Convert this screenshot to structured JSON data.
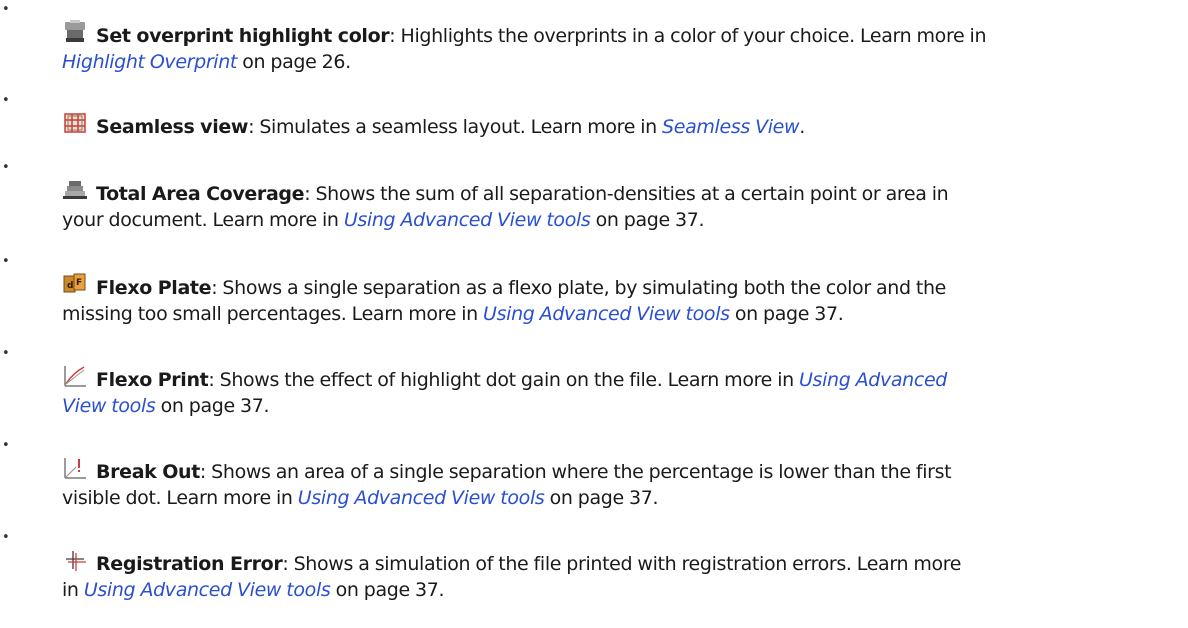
{
  "colors": {
    "text": "#1a1a1a",
    "link": "#2a4fd0",
    "icon_red": "#d23a3a",
    "icon_gray": "#8a8a8a"
  },
  "items": [
    {
      "icon": "overprint-highlight-icon",
      "term": "Set overprint highlight color",
      "desc": ": Highlights the overprints in a color of your choice. Learn more in",
      "link": "Highlight Overprint",
      "after": " on page 26."
    },
    {
      "icon": "seamless-view-icon",
      "term": "Seamless view",
      "desc": ": Simulates a seamless layout. Learn more in ",
      "link": "Seamless View",
      "after": "."
    },
    {
      "icon": "total-area-coverage-icon",
      "term": "Total Area Coverage",
      "desc": ": Shows the sum of all separation-densities at a certain point or area in",
      "desc2": "your document. Learn more in ",
      "link": "Using Advanced View tools",
      "after": " on page 37."
    },
    {
      "icon": "flexo-plate-icon",
      "term": "Flexo Plate",
      "desc": ": Shows a single separation as a flexo plate, by simulating both the color and the",
      "desc2": "missing too small percentages. Learn more in ",
      "link": "Using Advanced View tools",
      "after": " on page 37."
    },
    {
      "icon": "flexo-print-icon",
      "term": "Flexo Print",
      "desc": ": Shows the effect of highlight dot gain on the file. Learn more in ",
      "link_part1": "Using Advanced",
      "link_part2": "View tools",
      "after": " on page 37."
    },
    {
      "icon": "break-out-icon",
      "term": "Break Out",
      "desc": ": Shows an area of a single separation where the percentage is lower than the first",
      "desc2": "visible dot. Learn more in ",
      "link": "Using Advanced View tools",
      "after": " on page 37."
    },
    {
      "icon": "registration-error-icon",
      "term": "Registration Error",
      "desc": ": Shows a simulation of the file printed with registration errors. Learn more",
      "desc2": "in ",
      "link": "Using Advanced View tools",
      "after": " on page 37."
    }
  ]
}
